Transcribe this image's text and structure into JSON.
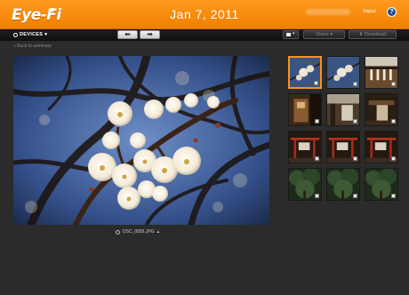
{
  "header": {
    "logo": "Eye-Fi",
    "title": "Jan 7, 2011",
    "logout_label": "logout",
    "help_label": "?"
  },
  "toolbar": {
    "devices_label": "DEVICES",
    "prev_label": "⬅",
    "next_label": "➡",
    "share_label": "Share ▾",
    "download_label": "⬇ Download"
  },
  "breadcrumb": {
    "back_label": "« Back to summary"
  },
  "photo": {
    "filename": "DSC_0005.JPG"
  },
  "thumbnails": {
    "selected_index": 0,
    "items": [
      {
        "scene": "blossom"
      },
      {
        "scene": "blossom"
      },
      {
        "scene": "shrine-beam"
      },
      {
        "scene": "lantern"
      },
      {
        "scene": "gate"
      },
      {
        "scene": "shrine-dark"
      },
      {
        "scene": "torii"
      },
      {
        "scene": "torii"
      },
      {
        "scene": "torii"
      },
      {
        "scene": "forest"
      },
      {
        "scene": "forest"
      },
      {
        "scene": "forest"
      }
    ]
  },
  "colors": {
    "header_orange": "#f28a0f",
    "selected_border": "#f7931e",
    "background": "#2b2b2b"
  }
}
